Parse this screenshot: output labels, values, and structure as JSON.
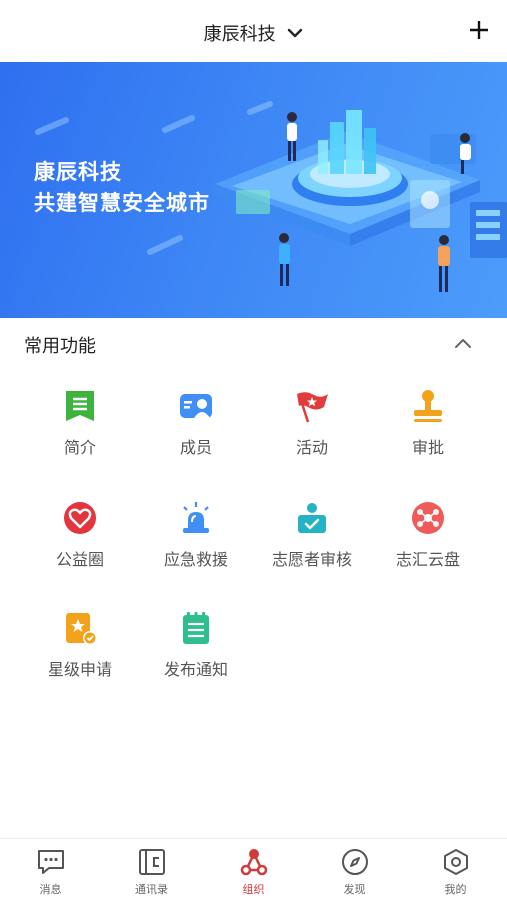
{
  "header": {
    "title": "康辰科技",
    "dropdown_icon": "chevron-down-icon",
    "add_icon": "plus-icon"
  },
  "banner": {
    "line1": "康辰科技",
    "line2": "共建智慧安全城市"
  },
  "section": {
    "title": "常用功能",
    "collapse_icon": "chevron-up-icon"
  },
  "functions": [
    {
      "label": "简介",
      "icon": "bookmark-doc-icon",
      "color": "#3db33d"
    },
    {
      "label": "成员",
      "icon": "member-card-icon",
      "color": "#3f8ff5"
    },
    {
      "label": "活动",
      "icon": "red-flag-icon",
      "color": "#e23b3b"
    },
    {
      "label": "审批",
      "icon": "stamp-icon",
      "color": "#f2a21b"
    },
    {
      "label": "公益圈",
      "icon": "heart-circle-icon",
      "color": "#e2353d"
    },
    {
      "label": "应急救援",
      "icon": "siren-icon",
      "color": "#3f8ff5"
    },
    {
      "label": "志愿者审核",
      "icon": "volunteer-check-icon",
      "color": "#23b3c4"
    },
    {
      "label": "志汇云盘",
      "icon": "cloud-disk-icon",
      "color": "#ef5a5a"
    },
    {
      "label": "星级申请",
      "icon": "star-badge-icon",
      "color": "#f2a21b"
    },
    {
      "label": "发布通知",
      "icon": "notepad-icon",
      "color": "#2fbf8f"
    }
  ],
  "tabs": [
    {
      "label": "消息",
      "icon": "message-icon"
    },
    {
      "label": "通讯录",
      "icon": "contacts-icon"
    },
    {
      "label": "组织",
      "icon": "organization-icon",
      "active": true
    },
    {
      "label": "发现",
      "icon": "compass-icon"
    },
    {
      "label": "我的",
      "icon": "hexagon-settings-icon"
    }
  ],
  "colors": {
    "accent": "#d23a3a",
    "banner_blue": "#3d86f5"
  }
}
